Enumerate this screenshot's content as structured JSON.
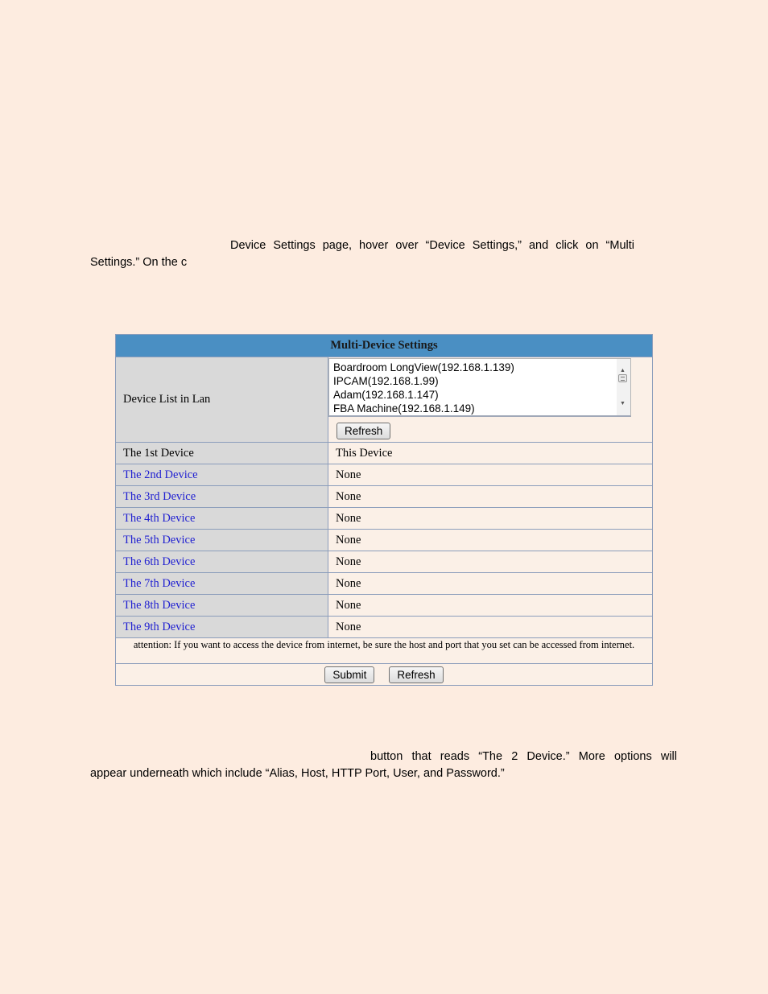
{
  "paragraphs": {
    "intro_line1": "Device Settings page, hover over “Device Settings,” and click on “Multi",
    "intro_line2": "Settings.” On the c",
    "outro_line1": "button that reads “The 2    Device.” More options will",
    "outro_line2": "appear underneath which include “Alias, Host, HTTP Port, User, and Password.”"
  },
  "panel": {
    "title": "Multi-Device Settings",
    "lan_label": "Device List in Lan",
    "lan_devices": [
      "Boardroom LongView(192.168.1.139)",
      "IPCAM(192.168.1.99)",
      "Adam(192.168.1.147)",
      "FBA Machine(192.168.1.149)"
    ],
    "lan_refresh_label": "Refresh",
    "devices": [
      {
        "label": "The 1st Device",
        "value": "This Device"
      },
      {
        "label": "The 2nd Device",
        "value": "None"
      },
      {
        "label": "The 3rd Device",
        "value": "None"
      },
      {
        "label": "The 4th Device",
        "value": "None"
      },
      {
        "label": "The 5th Device",
        "value": "None"
      },
      {
        "label": "The 6th Device",
        "value": "None"
      },
      {
        "label": "The 7th Device",
        "value": "None"
      },
      {
        "label": "The 8th Device",
        "value": "None"
      },
      {
        "label": "The 9th Device",
        "value": "None"
      }
    ],
    "attention": "attention: If you want to access the device from internet, be sure the host and port that you set can be accessed from internet.",
    "submit_label": "Submit",
    "refresh_label": "Refresh"
  },
  "colors": {
    "page_bg": "#fdece0",
    "header_bg": "#4a8fc3",
    "label_bg": "#d9d9d9",
    "link": "#1f1fd1"
  }
}
